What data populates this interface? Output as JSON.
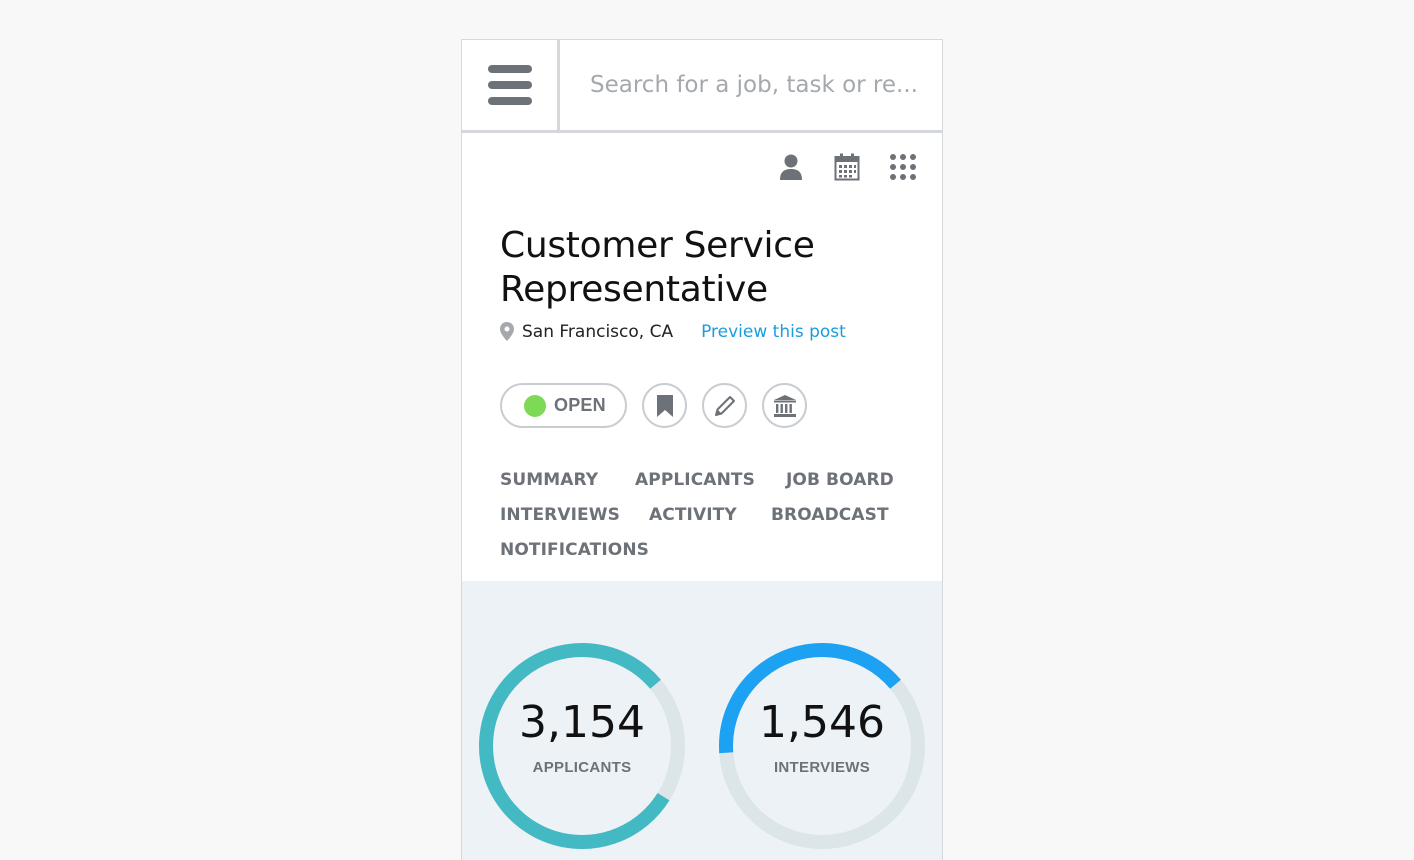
{
  "search": {
    "placeholder": "Search for a job, task or re..."
  },
  "header_icons": [
    "user-icon",
    "calendar-icon",
    "apps-grid-icon"
  ],
  "job": {
    "title": "Customer Service Representative",
    "location": "San Francisco, CA",
    "preview_link": "Preview this post"
  },
  "status": {
    "label": "OPEN",
    "color": "#7ed957"
  },
  "action_icons": [
    "bookmark-icon",
    "pencil-icon",
    "bank-icon"
  ],
  "tabs": [
    {
      "label": "SUMMARY"
    },
    {
      "label": "APPLICANTS"
    },
    {
      "label": "JOB BOARD"
    },
    {
      "label": "INTERVIEWS"
    },
    {
      "label": "ACTIVITY"
    },
    {
      "label": "BROADCAST"
    },
    {
      "label": "NOTIFICATIONS"
    }
  ],
  "stats": [
    {
      "value": "3,154",
      "label": "APPLICANTS",
      "progress": 0.8,
      "color": "#43b9c3"
    },
    {
      "value": "1,546",
      "label": "INTERVIEWS",
      "progress": 0.4,
      "color": "#1da1f2"
    }
  ],
  "colors": {
    "accent": "#1a9de0",
    "muted": "#6d7178",
    "ring_track": "#dce5e8"
  }
}
